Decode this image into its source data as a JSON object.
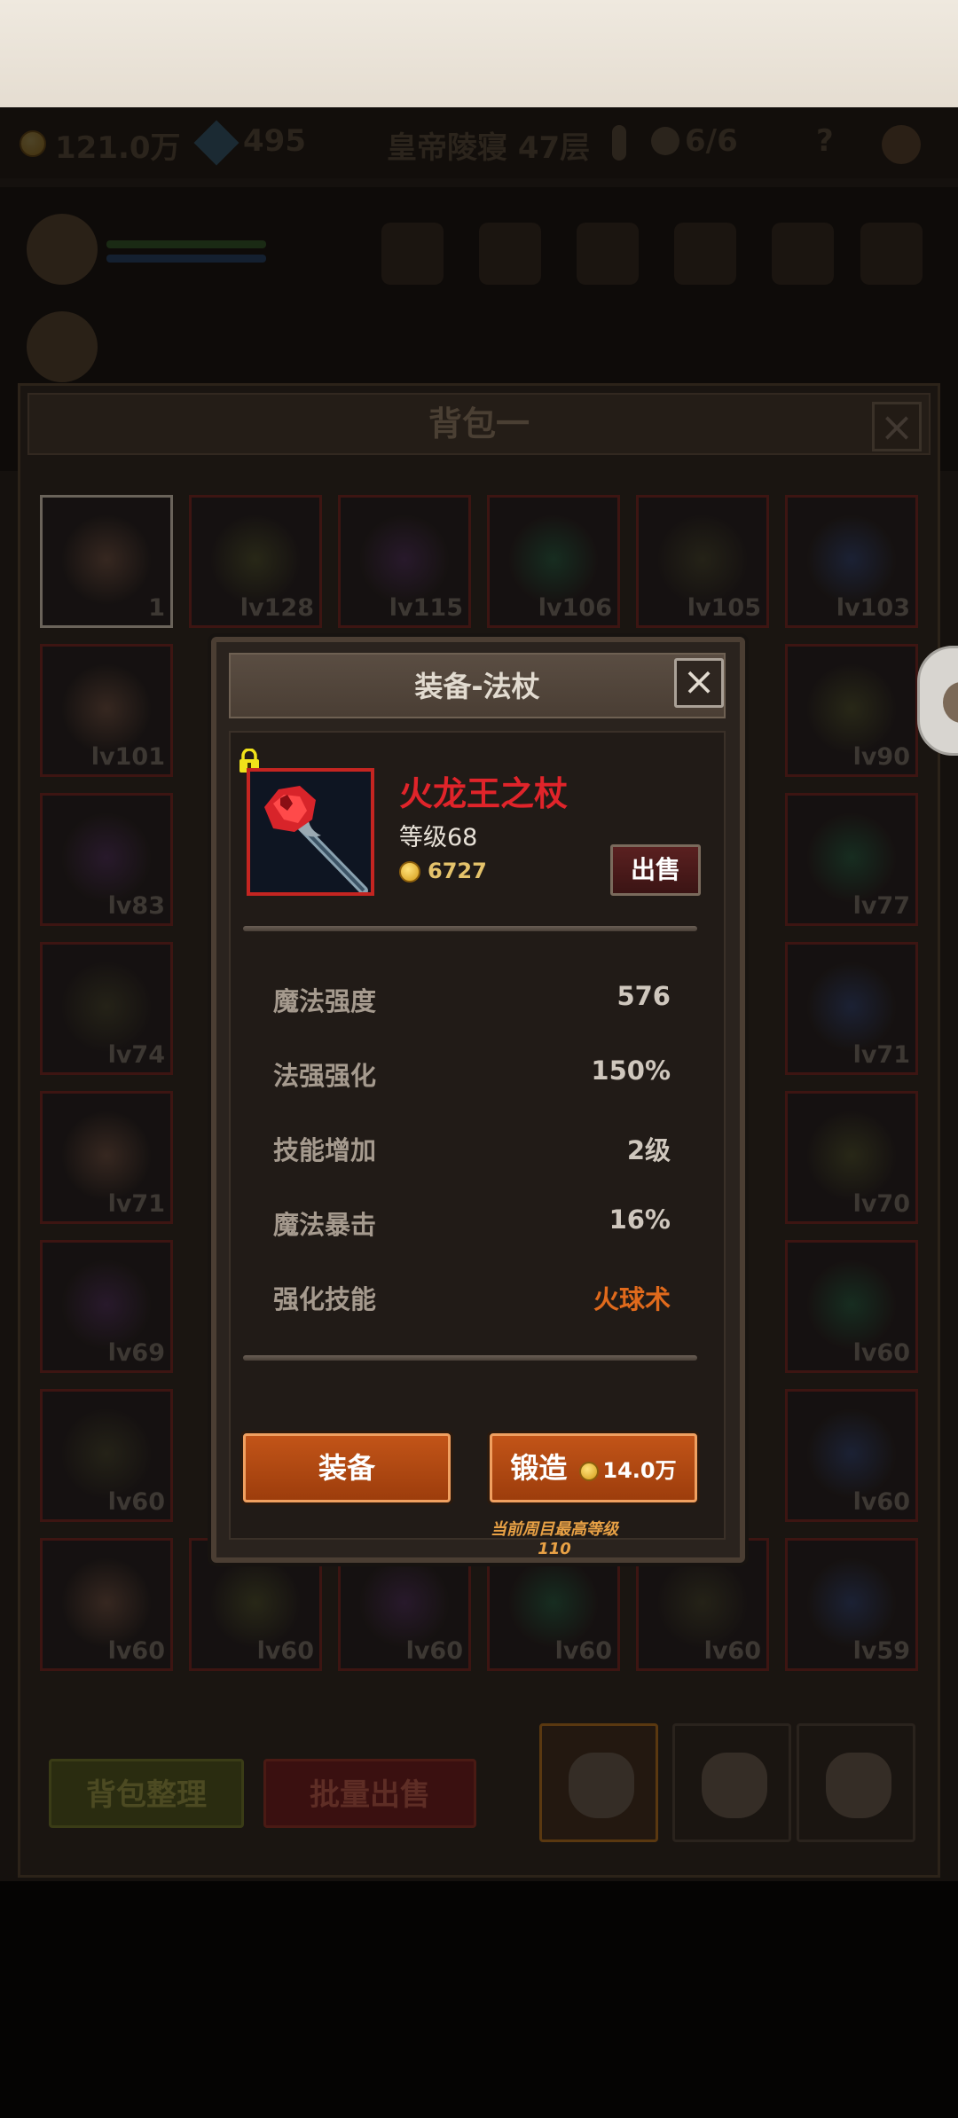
{
  "hud": {
    "gold": "121.0万",
    "gems": "495",
    "location": "皇帝陵寝 47层",
    "keys": "6/6",
    "help_icon": "question-icon"
  },
  "backpack": {
    "title": "背包一",
    "slots": [
      {
        "label": "1"
      },
      {
        "label": "lv128"
      },
      {
        "label": "lv115"
      },
      {
        "label": "lv106"
      },
      {
        "label": "lv105"
      },
      {
        "label": "lv103"
      },
      {
        "label": "lv101"
      },
      {
        "label": "lv90"
      },
      {
        "label": "lv83"
      },
      {
        "label": "lv77"
      },
      {
        "label": "lv74"
      },
      {
        "label": "lv71"
      },
      {
        "label": "lv71"
      },
      {
        "label": "lv70"
      },
      {
        "label": "lv69"
      },
      {
        "label": "lv60"
      },
      {
        "label": "lv60"
      },
      {
        "label": "lv60"
      },
      {
        "label": "lv60"
      },
      {
        "label": "lv60"
      },
      {
        "label": "lv60"
      },
      {
        "label": "lv60"
      },
      {
        "label": "lv60"
      },
      {
        "label": "lv59"
      }
    ],
    "sort_label": "背包整理",
    "bulk_sell_label": "批量出售"
  },
  "modal": {
    "title": "装备-法杖",
    "item": {
      "name": "火龙王之杖",
      "level": "等级68",
      "price": "6727",
      "sell_label": "出售"
    },
    "stats": [
      {
        "label": "魔法强度",
        "value": "576"
      },
      {
        "label": "法强强化",
        "value": "150%"
      },
      {
        "label": "技能增加",
        "value": "2级"
      },
      {
        "label": "魔法暴击",
        "value": "16%"
      },
      {
        "label": "强化技能",
        "value": "火球术"
      }
    ],
    "equip_label": "装备",
    "forge_label": "锻造",
    "forge_cost": "14.0万",
    "max_level_note": "当前周目最高等级110"
  },
  "colors": {
    "item_name": "#e0242a",
    "skill_value": "#e06a1c",
    "action_button": "#c25418"
  }
}
